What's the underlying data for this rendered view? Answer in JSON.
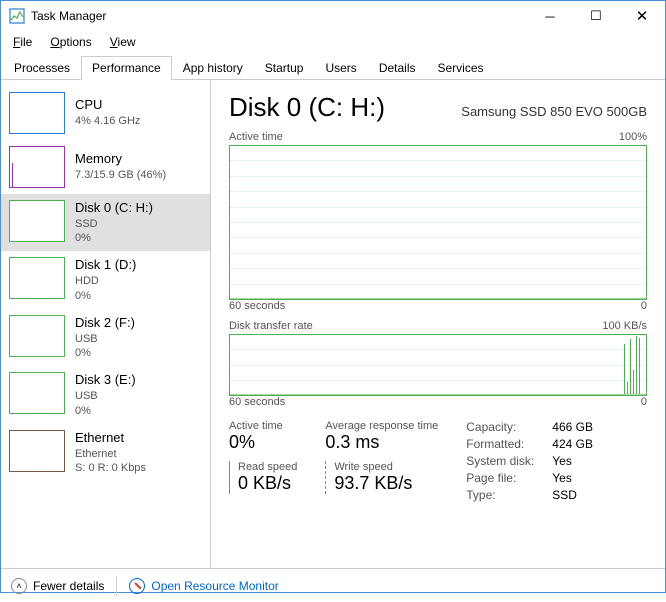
{
  "window": {
    "title": "Task Manager"
  },
  "menubar": {
    "file": "File",
    "options": "Options",
    "view": "View"
  },
  "tabs": [
    "Processes",
    "Performance",
    "App history",
    "Startup",
    "Users",
    "Details",
    "Services"
  ],
  "sidebar": {
    "items": [
      {
        "name": "CPU",
        "sub1": "4% 4.16 GHz",
        "sub2": ""
      },
      {
        "name": "Memory",
        "sub1": "7.3/15.9 GB (46%)",
        "sub2": ""
      },
      {
        "name": "Disk 0 (C: H:)",
        "sub1": "SSD",
        "sub2": "0%"
      },
      {
        "name": "Disk 1 (D:)",
        "sub1": "HDD",
        "sub2": "0%"
      },
      {
        "name": "Disk 2 (F:)",
        "sub1": "USB",
        "sub2": "0%"
      },
      {
        "name": "Disk 3 (E:)",
        "sub1": "USB",
        "sub2": "0%"
      },
      {
        "name": "Ethernet",
        "sub1": "Ethernet",
        "sub2": "S: 0 R: 0 Kbps"
      }
    ]
  },
  "main": {
    "title": "Disk 0 (C: H:)",
    "model": "Samsung SSD 850 EVO 500GB",
    "chart1": {
      "left_label": "Active time",
      "right_label": "100%",
      "xaxis_left": "60 seconds",
      "xaxis_right": "0"
    },
    "chart2": {
      "left_label": "Disk transfer rate",
      "right_label": "100 KB/s",
      "xaxis_left": "60 seconds",
      "xaxis_right": "0"
    },
    "stats": {
      "active_time": {
        "label": "Active time",
        "value": "0%"
      },
      "avg_response": {
        "label": "Average response time",
        "value": "0.3 ms"
      },
      "read_speed": {
        "label": "Read speed",
        "value": "0 KB/s"
      },
      "write_speed": {
        "label": "Write speed",
        "value": "93.7 KB/s"
      }
    },
    "kv": {
      "capacity_k": "Capacity:",
      "capacity_v": "466 GB",
      "formatted_k": "Formatted:",
      "formatted_v": "424 GB",
      "sysdisk_k": "System disk:",
      "sysdisk_v": "Yes",
      "pagefile_k": "Page file:",
      "pagefile_v": "Yes",
      "type_k": "Type:",
      "type_v": "SSD"
    }
  },
  "footer": {
    "fewer": "Fewer details",
    "rm": "Open Resource Monitor"
  },
  "chart_data": [
    {
      "type": "line",
      "title": "Active time",
      "xlabel": "60 seconds",
      "ylabel": "%",
      "ylim": [
        0,
        100
      ],
      "x_range_seconds": [
        60,
        0
      ],
      "values": [
        0,
        0,
        0,
        0,
        0,
        0,
        0,
        0,
        0,
        0,
        0,
        0,
        0,
        0,
        0,
        0,
        0,
        0,
        0,
        0,
        0,
        0,
        0,
        0,
        0,
        0,
        0,
        0,
        0,
        0,
        0,
        0,
        0,
        0,
        0,
        0,
        0,
        0,
        0,
        0,
        0,
        0,
        0,
        0,
        0,
        0,
        0,
        0,
        0,
        0,
        0,
        0,
        0,
        0,
        0,
        0,
        0,
        0,
        0,
        0
      ]
    },
    {
      "type": "line",
      "title": "Disk transfer rate",
      "xlabel": "60 seconds",
      "ylabel": "KB/s",
      "ylim": [
        0,
        100
      ],
      "x_range_seconds": [
        60,
        0
      ],
      "series": [
        {
          "name": "Read",
          "values": [
            0,
            0,
            0,
            0,
            0,
            0,
            0,
            0,
            0,
            0,
            0,
            0,
            0,
            0,
            0,
            0,
            0,
            0,
            0,
            0,
            0,
            0,
            0,
            0,
            0,
            0,
            0,
            0,
            0,
            0,
            0,
            0,
            0,
            0,
            0,
            0,
            0,
            0,
            0,
            0,
            0,
            0,
            0,
            0,
            0,
            0,
            0,
            0,
            0,
            0,
            0,
            0,
            0,
            0,
            0,
            0,
            0,
            0,
            0,
            0
          ]
        },
        {
          "name": "Write",
          "values": [
            0,
            0,
            0,
            0,
            0,
            0,
            0,
            0,
            0,
            0,
            0,
            0,
            0,
            0,
            0,
            0,
            0,
            0,
            0,
            0,
            0,
            0,
            0,
            0,
            0,
            0,
            0,
            0,
            0,
            0,
            0,
            0,
            0,
            0,
            0,
            0,
            0,
            0,
            0,
            0,
            0,
            0,
            0,
            0,
            0,
            0,
            0,
            0,
            0,
            0,
            0,
            0,
            0,
            0,
            85,
            20,
            95,
            40,
            98,
            94
          ]
        }
      ]
    }
  ]
}
